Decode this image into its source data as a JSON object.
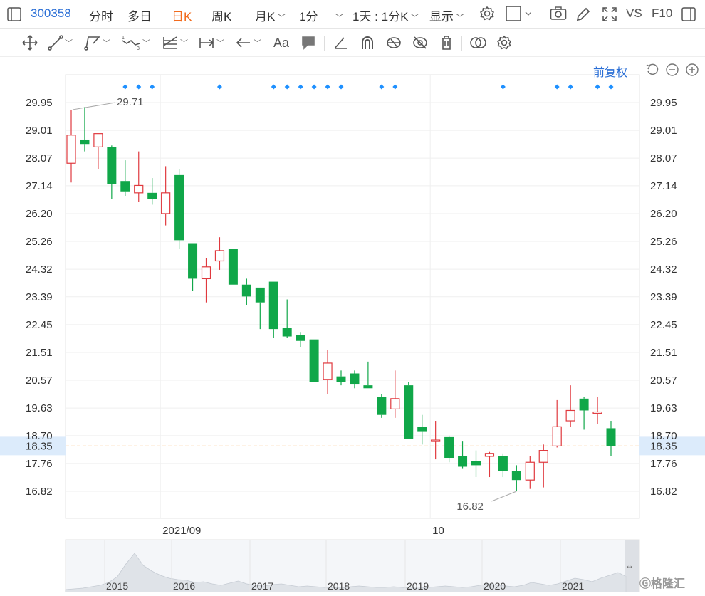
{
  "header": {
    "symbol": "300358",
    "tabs": [
      {
        "label": "分时",
        "active": false
      },
      {
        "label": "多日",
        "active": false
      },
      {
        "label": "日K",
        "active": true
      },
      {
        "label": "周K",
        "active": false
      },
      {
        "label": "月K",
        "active": false
      },
      {
        "label": "1分",
        "active": false
      }
    ],
    "period_select": "1天 : 1分K",
    "display_label": "显示",
    "vs_label": "VS",
    "f10_label": "F10"
  },
  "toolbar": {
    "font_label": "Aa"
  },
  "chart_controls": {
    "adjust_label": "前复权"
  },
  "colors": {
    "up": "#e0393e",
    "down": "#10a749",
    "accent": "#2b6fd6",
    "price_line": "#f29933",
    "marker": "#1e90ff"
  },
  "chart_data": {
    "type": "candlestick",
    "y_ticks": [
      "29.95",
      "29.01",
      "28.07",
      "27.14",
      "26.20",
      "25.26",
      "24.32",
      "23.39",
      "22.45",
      "21.51",
      "20.57",
      "19.63",
      "18.70",
      "17.76",
      "16.82"
    ],
    "ylim": [
      16.82,
      29.95
    ],
    "x_labels": [
      {
        "label": "2021/09",
        "index": 7
      },
      {
        "label": "10",
        "index": 27
      }
    ],
    "max_annotation": "29.71",
    "min_annotation": "16.82",
    "current_price": "18.35",
    "marker_indices": [
      4,
      5,
      6,
      11,
      15,
      16,
      17,
      18,
      19,
      20,
      23,
      24,
      32,
      36,
      37,
      39,
      40
    ],
    "candles": [
      {
        "o": 27.9,
        "h": 29.71,
        "l": 27.25,
        "c": 28.85
      },
      {
        "o": 28.7,
        "h": 29.8,
        "l": 28.3,
        "c": 28.55
      },
      {
        "o": 28.45,
        "h": 28.9,
        "l": 27.7,
        "c": 28.9
      },
      {
        "o": 28.45,
        "h": 28.5,
        "l": 26.7,
        "c": 27.2
      },
      {
        "o": 27.3,
        "h": 28.0,
        "l": 26.8,
        "c": 26.95
      },
      {
        "o": 26.9,
        "h": 28.3,
        "l": 26.6,
        "c": 27.15
      },
      {
        "o": 26.9,
        "h": 27.4,
        "l": 26.5,
        "c": 26.7
      },
      {
        "o": 26.2,
        "h": 27.8,
        "l": 25.8,
        "c": 26.9
      },
      {
        "o": 27.5,
        "h": 27.7,
        "l": 25.0,
        "c": 25.3
      },
      {
        "o": 25.2,
        "h": 25.2,
        "l": 23.6,
        "c": 24.0
      },
      {
        "o": 24.0,
        "h": 24.7,
        "l": 23.2,
        "c": 24.4
      },
      {
        "o": 24.6,
        "h": 25.4,
        "l": 24.3,
        "c": 24.95
      },
      {
        "o": 25.0,
        "h": 25.0,
        "l": 23.8,
        "c": 23.8
      },
      {
        "o": 23.8,
        "h": 24.0,
        "l": 23.1,
        "c": 23.4
      },
      {
        "o": 23.7,
        "h": 23.7,
        "l": 22.3,
        "c": 23.2
      },
      {
        "o": 23.9,
        "h": 23.9,
        "l": 22.0,
        "c": 22.3
      },
      {
        "o": 22.35,
        "h": 23.3,
        "l": 22.0,
        "c": 22.05
      },
      {
        "o": 22.1,
        "h": 22.2,
        "l": 21.7,
        "c": 21.9
      },
      {
        "o": 21.95,
        "h": 21.95,
        "l": 20.5,
        "c": 20.5
      },
      {
        "o": 20.6,
        "h": 21.6,
        "l": 20.1,
        "c": 21.15
      },
      {
        "o": 20.7,
        "h": 20.9,
        "l": 20.4,
        "c": 20.5
      },
      {
        "o": 20.8,
        "h": 20.9,
        "l": 20.3,
        "c": 20.45
      },
      {
        "o": 20.4,
        "h": 21.2,
        "l": 20.3,
        "c": 20.3
      },
      {
        "o": 20.0,
        "h": 20.1,
        "l": 19.3,
        "c": 19.4
      },
      {
        "o": 19.6,
        "h": 20.9,
        "l": 19.3,
        "c": 19.95
      },
      {
        "o": 20.4,
        "h": 20.5,
        "l": 18.6,
        "c": 18.6
      },
      {
        "o": 19.0,
        "h": 19.4,
        "l": 18.4,
        "c": 18.85
      },
      {
        "o": 18.55,
        "h": 19.2,
        "l": 17.9,
        "c": 18.55
      },
      {
        "o": 18.65,
        "h": 18.7,
        "l": 17.8,
        "c": 17.95
      },
      {
        "o": 18.0,
        "h": 18.5,
        "l": 17.6,
        "c": 17.65
      },
      {
        "o": 17.85,
        "h": 18.2,
        "l": 17.3,
        "c": 17.7
      },
      {
        "o": 18.0,
        "h": 18.15,
        "l": 17.3,
        "c": 18.1
      },
      {
        "o": 18.0,
        "h": 18.1,
        "l": 17.3,
        "c": 17.5
      },
      {
        "o": 17.5,
        "h": 17.7,
        "l": 16.82,
        "c": 17.2
      },
      {
        "o": 17.2,
        "h": 18.0,
        "l": 16.9,
        "c": 17.8
      },
      {
        "o": 17.8,
        "h": 18.4,
        "l": 16.95,
        "c": 18.2
      },
      {
        "o": 18.35,
        "h": 19.9,
        "l": 18.3,
        "c": 19.0
      },
      {
        "o": 19.2,
        "h": 20.4,
        "l": 19.0,
        "c": 19.55
      },
      {
        "o": 19.95,
        "h": 20.0,
        "l": 18.9,
        "c": 19.55
      },
      {
        "o": 19.45,
        "h": 20.0,
        "l": 19.1,
        "c": 19.5
      },
      {
        "o": 18.95,
        "h": 19.2,
        "l": 18.0,
        "c": 18.35
      }
    ],
    "overview_years": [
      "2015",
      "2016",
      "2017",
      "2018",
      "2019",
      "2020",
      "2021"
    ]
  },
  "watermark": "格隆汇"
}
